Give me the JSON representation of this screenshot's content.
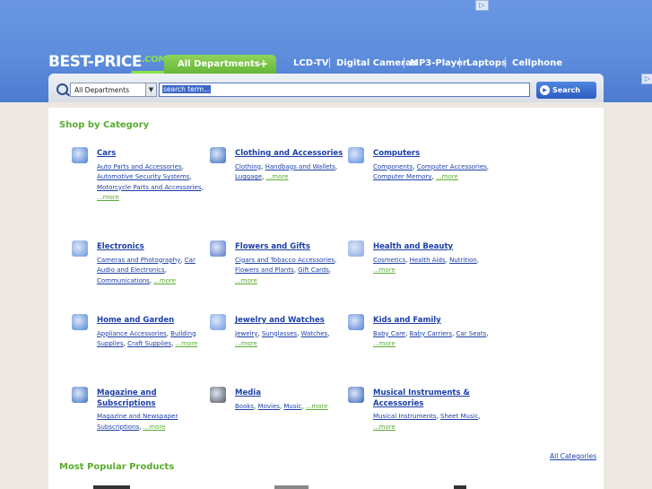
{
  "header": {
    "logo_main": "BEST-PRICE",
    "logo_com": ".COM",
    "ad_marker": "▷",
    "nav": {
      "all_departments": "All Departments",
      "all_plus": "+",
      "links": [
        "LCD-TV",
        "Digital Cameras",
        "MP3-Player",
        "Laptops",
        "Cellphone"
      ]
    }
  },
  "search": {
    "department": "All Departments",
    "input_value": "search term...",
    "button": "Search"
  },
  "shop_title": "Shop by Category",
  "categories": [
    {
      "title": "Cars",
      "links": [
        "Auto Parts and Accessories",
        "Automotive Security Systems",
        "Motorcycle Parts and Accessories"
      ],
      "more": "...more"
    },
    {
      "title": "Clothing and Accessories",
      "links": [
        "Clothing",
        "Handbags and Wallets",
        "Luggage"
      ],
      "more": "...more"
    },
    {
      "title": "Computers",
      "links": [
        "Components",
        "Computer Accessories",
        "Computer Memory"
      ],
      "more": "...more"
    },
    {
      "title": "Electronics",
      "links": [
        "Cameras and Photography",
        "Car Audio and Electronics",
        "Communications"
      ],
      "more": "...more"
    },
    {
      "title": "Flowers and Gifts",
      "links": [
        "Cigars and Tobacco Accessories",
        "Flowers and Plants",
        "Gift Cards"
      ],
      "more": "...more"
    },
    {
      "title": "Health and Beauty",
      "links": [
        "Cosmetics",
        "Health Aids",
        "Nutrition"
      ],
      "more": "...more"
    },
    {
      "title": "Home and Garden",
      "links": [
        "Appliance Accessories",
        "Building Supplies",
        "Craft Supplies"
      ],
      "more": "...more"
    },
    {
      "title": "Jewelry and Watches",
      "links": [
        "Jewelry",
        "Sunglasses",
        "Watches"
      ],
      "more": "...more"
    },
    {
      "title": "Kids and Family",
      "links": [
        "Baby Care",
        "Baby Carriers",
        "Car Seats"
      ],
      "more": "...more"
    },
    {
      "title": "Magazine and Subscriptions",
      "links": [
        "Magazine and Newspaper Subscriptions"
      ],
      "more": "...more"
    },
    {
      "title": "Media",
      "links": [
        "Books",
        "Movies",
        "Music"
      ],
      "more": "...more"
    },
    {
      "title": "Musical Instruments & Accessories",
      "links": [
        "Musical Instruments",
        "Sheet Music"
      ],
      "more": "...more"
    }
  ],
  "all_categories": "All Categories",
  "popular_title": "Most Popular Products",
  "icons": [
    "car-icon",
    "clothing-icon",
    "computer-icon",
    "electronics-icon",
    "gift-icon",
    "health-icon",
    "home-icon",
    "watch-icon",
    "kids-icon",
    "magazine-icon",
    "media-icon",
    "guitar-icon"
  ],
  "colors": {
    "header_blue": "#5e8ddc",
    "nav_green": "#66b637",
    "link_blue": "#1c3fa8",
    "title_green": "#5aac2f"
  }
}
